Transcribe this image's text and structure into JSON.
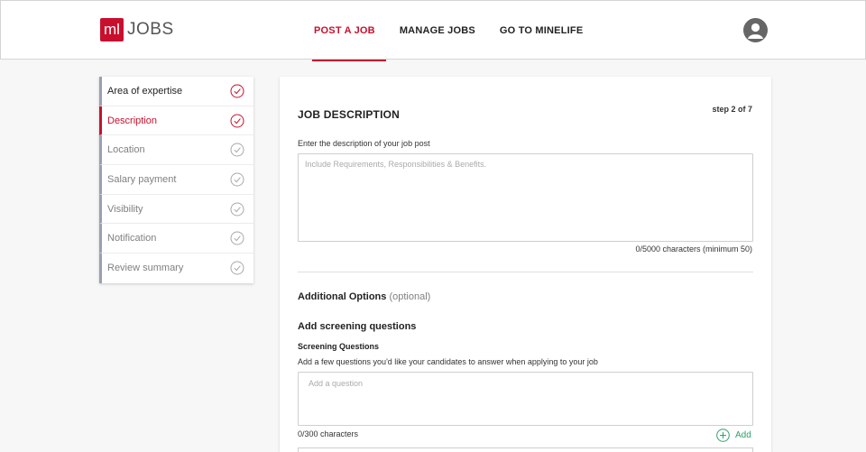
{
  "header": {
    "logo_mark": "ml",
    "logo_text": "JOBS",
    "nav": [
      {
        "label": "POST A JOB",
        "active": true
      },
      {
        "label": "MANAGE JOBS",
        "active": false
      },
      {
        "label": "GO TO MINELIFE",
        "active": false
      }
    ]
  },
  "sidebar": {
    "steps": [
      {
        "label": "Area of expertise",
        "state": "done"
      },
      {
        "label": "Description",
        "state": "active"
      },
      {
        "label": "Location",
        "state": "pending"
      },
      {
        "label": "Salary payment",
        "state": "pending"
      },
      {
        "label": "Visibility",
        "state": "pending"
      },
      {
        "label": "Notification",
        "state": "pending"
      },
      {
        "label": "Review summary",
        "state": "pending"
      }
    ]
  },
  "main": {
    "title": "JOB DESCRIPTION",
    "step_indicator": "step 2 of 7",
    "description": {
      "label": "Enter the description of your job post",
      "placeholder": "Include Requirements, Responsibilities & Benefits.",
      "value": "",
      "counter": "0/5000 characters (minimum 50)"
    },
    "additional_options": {
      "title": "Additional Options",
      "optional": "(optional)"
    },
    "screening": {
      "title": "Add screening questions",
      "subtitle": "Screening Questions",
      "help": "Add a few questions you'd like your candidates to answer when applying to your job",
      "placeholder": "Add a question",
      "value": "",
      "counter": "0/300 characters",
      "add_label": "Add"
    }
  },
  "colors": {
    "brand": "#c8102e",
    "add_green": "#2aa26a",
    "pending_check": "#a9a9a9"
  }
}
